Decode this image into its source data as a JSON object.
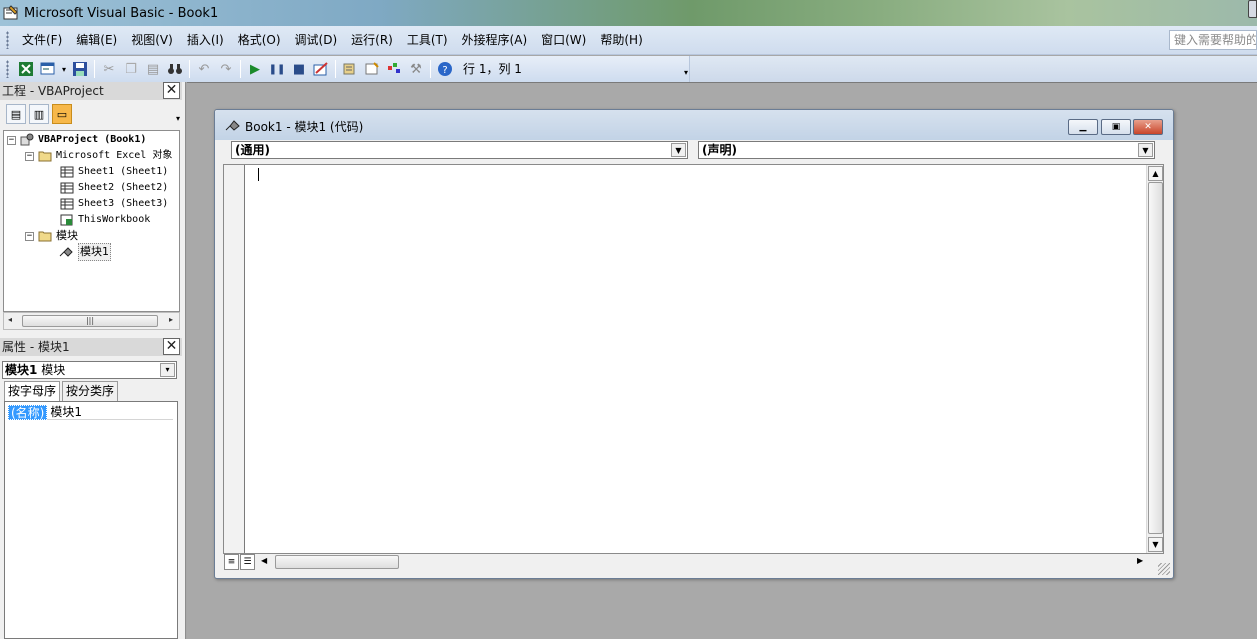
{
  "window": {
    "title": "Microsoft Visual Basic - Book1"
  },
  "menu": {
    "items": [
      "文件(F)",
      "编辑(E)",
      "视图(V)",
      "插入(I)",
      "格式(O)",
      "调试(D)",
      "运行(R)",
      "工具(T)",
      "外接程序(A)",
      "窗口(W)",
      "帮助(H)"
    ],
    "help_placeholder": "键入需要帮助的"
  },
  "toolbar": {
    "cursor_position": "行 1，列 1"
  },
  "project_pane": {
    "title": "工程 - VBAProject",
    "tree": {
      "root": "VBAProject (Book1)",
      "excel_objects_folder": "Microsoft Excel 对象",
      "sheet1": "Sheet1 (Sheet1)",
      "sheet2": "Sheet2 (Sheet2)",
      "sheet3": "Sheet3 (Sheet3)",
      "this_workbook": "ThisWorkbook",
      "modules_folder": "模块",
      "module1": "模块1"
    }
  },
  "properties_pane": {
    "title": "属性 - 模块1",
    "object_name": "模块1",
    "object_type": "模块",
    "tabs": [
      "按字母序",
      "按分类序"
    ],
    "rows": [
      {
        "key": "(名称)",
        "value": "模块1"
      }
    ]
  },
  "code_window": {
    "title": "Book1 - 模块1 (代码)",
    "object_dropdown": "(通用)",
    "procedure_dropdown": "(声明)"
  }
}
